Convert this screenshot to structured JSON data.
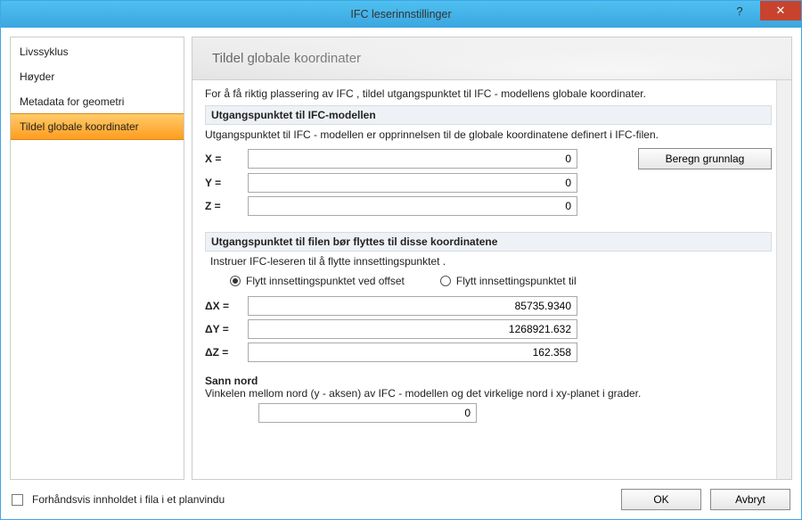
{
  "window": {
    "title": "IFC leserinnstillinger",
    "help": "?",
    "close": "✕"
  },
  "sidebar": {
    "items": [
      {
        "label": "Livssyklus"
      },
      {
        "label": "Høyder"
      },
      {
        "label": "Metadata for geometri"
      },
      {
        "label": "Tildel globale koordinater"
      }
    ]
  },
  "banner": {
    "title": "Tildel globale koordinater"
  },
  "intro": "For å få riktig plassering av IFC , tildel utgangspunktet til IFC - modellens globale koordinater.",
  "sec1": {
    "header": "Utgangspunktet til IFC-modellen",
    "sub": "Utgangspunktet til IFC - modellen er opprinnelsen til de globale koordinatene definert i IFC-filen.",
    "x_label": "X =",
    "y_label": "Y =",
    "z_label": "Z =",
    "x_val": "0",
    "y_val": "0",
    "z_val": "0",
    "compute_btn": "Beregn grunnlag"
  },
  "sec2": {
    "header": "Utgangspunktet til filen bør flyttes til disse koordinatene",
    "sub": "Instruer IFC-leseren til å flytte innsettingspunktet .",
    "radio1": "Flytt innsettingspunktet ved offset",
    "radio2": "Flytt innsettingspunktet til",
    "dx_label": "ΔX =",
    "dy_label": "ΔY =",
    "dz_label": "ΔZ =",
    "dx_val": "85735.9340",
    "dy_val": "1268921.632",
    "dz_val": "162.358"
  },
  "sec3": {
    "header": "Sann nord",
    "sub": "Vinkelen mellom nord (y - aksen) av IFC - modellen og det virkelige nord i xy-planet i grader.",
    "angle_val": "0"
  },
  "footer": {
    "preview": "Forhåndsvis innholdet i fila i et planvindu",
    "ok": "OK",
    "cancel": "Avbryt"
  }
}
